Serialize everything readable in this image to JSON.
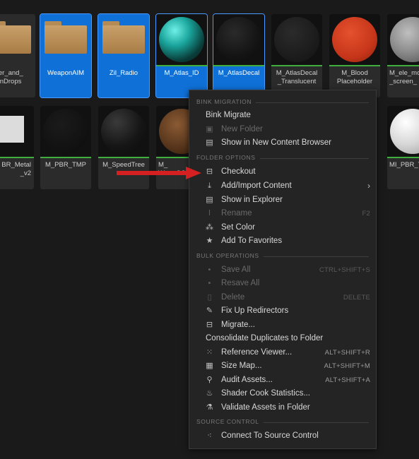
{
  "tiles_row1": [
    {
      "label1": "ter_and_",
      "label2": "inDrops",
      "kind": "folder",
      "selected": false
    },
    {
      "label1": "WeaponAIM",
      "label2": "",
      "kind": "folder",
      "selected": true
    },
    {
      "label1": "Zil_Radio",
      "label2": "",
      "kind": "folder",
      "selected": true
    },
    {
      "label1": "M_Atlas_ID",
      "label2": "",
      "kind": "teal-sphere",
      "selected": true
    },
    {
      "label1": "M_AtlasDecal",
      "label2": "",
      "kind": "dark-sphere",
      "selected": true
    },
    {
      "label1": "M_AtlasDecal",
      "label2": "_Translucent",
      "kind": "checker",
      "selected": false
    },
    {
      "label1": "M_Blood",
      "label2": "Placeholder",
      "kind": "red-sphere",
      "selected": false
    },
    {
      "label1": "M_ele_mo",
      "label2": "_screen_",
      "kind": "grey-sphere",
      "selected": false
    }
  ],
  "tiles_row2": [
    {
      "label1": "BR_Metal",
      "label2": "_v2",
      "kind": "white-square"
    },
    {
      "label1": "M_PBR_TMP",
      "label2": "",
      "kind": "black-sphere"
    },
    {
      "label1": "M_SpeedTree",
      "label2": "",
      "kind": "black-sphere"
    },
    {
      "label1": "M_",
      "label2": "WaterGS",
      "kind": "partial"
    },
    {
      "label1": "MI_PBR_T",
      "label2": "",
      "kind": "white-sphere"
    }
  ],
  "menu": {
    "sections": {
      "bink": "BINK MIGRATION",
      "folder": "FOLDER OPTIONS",
      "bulk": "BULK OPERATIONS",
      "source": "SOURCE CONTROL"
    },
    "items": {
      "bink_migrate": {
        "label": "Bink Migrate"
      },
      "new_folder": {
        "label": "New Folder",
        "icon": "folder-plus-icon"
      },
      "show_in_cb": {
        "label": "Show in New Content Browser",
        "icon": "folder-search-icon"
      },
      "checkout": {
        "label": "Checkout",
        "icon": "checkout-icon"
      },
      "add_import": {
        "label": "Add/Import Content",
        "icon": "import-icon"
      },
      "show_explorer": {
        "label": "Show in Explorer",
        "icon": "folder-search-icon"
      },
      "rename": {
        "label": "Rename",
        "shortcut": "F2",
        "icon": "rename-icon"
      },
      "set_color": {
        "label": "Set Color",
        "icon": "color-icon"
      },
      "add_fav": {
        "label": "Add To Favorites",
        "icon": "star-icon"
      },
      "save_all": {
        "label": "Save All",
        "shortcut": "CTRL+SHIFT+S",
        "icon": "save-icon"
      },
      "resave_all": {
        "label": "Resave All",
        "icon": "save-icon"
      },
      "delete": {
        "label": "Delete",
        "shortcut": "DELETE",
        "icon": "trash-icon"
      },
      "fix_redirectors": {
        "label": "Fix Up Redirectors",
        "icon": "wrench-icon"
      },
      "migrate": {
        "label": "Migrate...",
        "icon": "migrate-icon"
      },
      "consolidate": {
        "label": "Consolidate Duplicates to Folder"
      },
      "ref_viewer": {
        "label": "Reference Viewer...",
        "shortcut": "ALT+SHIFT+R",
        "icon": "graph-icon"
      },
      "size_map": {
        "label": "Size Map...",
        "shortcut": "ALT+SHIFT+M",
        "icon": "sizemap-icon"
      },
      "audit": {
        "label": "Audit Assets...",
        "shortcut": "ALT+SHIFT+A",
        "icon": "audit-icon"
      },
      "shader_cook": {
        "label": "Shader Cook Statistics...",
        "icon": "shader-icon"
      },
      "validate": {
        "label": "Validate Assets in Folder",
        "icon": "flask-icon"
      },
      "connect_sc": {
        "label": "Connect To Source Control",
        "icon": "source-control-icon"
      }
    }
  },
  "colors": {
    "selected": "#0f70d7",
    "accent_bar": "#3fae3f",
    "annotation": "#d42020"
  }
}
